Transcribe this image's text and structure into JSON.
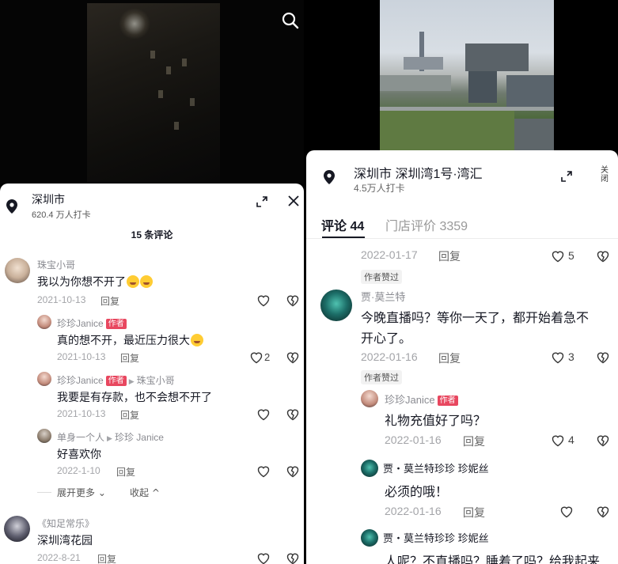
{
  "left": {
    "location": {
      "title": "深圳市",
      "checkins": "620.4 万人打卡"
    },
    "comment_count": "15 条评论",
    "comments": [
      {
        "name": "珠宝小哥",
        "text": "我以为你想不开了",
        "date": "2021-10-13",
        "reply": "回复",
        "likes": ""
      },
      {
        "name": "珍珍Janice",
        "tag": "作者",
        "text": "真的想不开，最近压力很大",
        "date": "2021-10-13",
        "reply": "回复",
        "likes": "2"
      },
      {
        "name": "珍珍Janice",
        "tag": "作者",
        "reply_to": "珠宝小哥",
        "text": "我要是有存款，也不会想不开了",
        "date": "2021-10-13",
        "reply": "回复",
        "likes": ""
      },
      {
        "name": "单身一个人",
        "reply_to": "珍珍 Janice",
        "text": "好喜欢你",
        "date": "2022-1-10",
        "reply": "回复",
        "likes": ""
      },
      {
        "name": "《知足常乐》",
        "text": "深圳湾花园",
        "date": "2022-8-21",
        "reply": "回复",
        "likes": ""
      }
    ],
    "expand_more": "展开更多",
    "collapse": "收起"
  },
  "right": {
    "location": {
      "title": "深圳市   深圳湾1号·湾汇",
      "checkins": "4.5万人打卡"
    },
    "close_label": "关闭",
    "tabs": [
      {
        "label": "评论 44"
      },
      {
        "label": "门店评价 3359"
      }
    ],
    "comments": [
      {
        "date": "2022-01-17",
        "reply": "回复",
        "likes": "5",
        "badge": "作者赞过"
      },
      {
        "name": "贾·莫兰特",
        "text_line1": "今晚直播吗？等你一天了，都开始着急不",
        "text_line2": "开心了。",
        "date": "2022-01-16",
        "reply": "回复",
        "likes": "3",
        "badge": "作者赞过"
      },
      {
        "name": "珍珍Janice",
        "tag": "作者",
        "text": "礼物充值好了吗？",
        "date": "2022-01-16",
        "reply": "回复",
        "likes": "4"
      },
      {
        "name": "贾・莫兰特珍珍 珍妮丝",
        "text": "必须的哦！",
        "date": "2022-01-16",
        "reply": "回复",
        "likes": ""
      },
      {
        "name": "贾・莫兰特珍珍 珍妮丝",
        "text": "人呢？不直播吗？睡着了吗？给我起来"
      }
    ]
  },
  "colors": {
    "author_tag": "#e8475f",
    "text": "#161823",
    "muted": "#a3a4a8"
  }
}
